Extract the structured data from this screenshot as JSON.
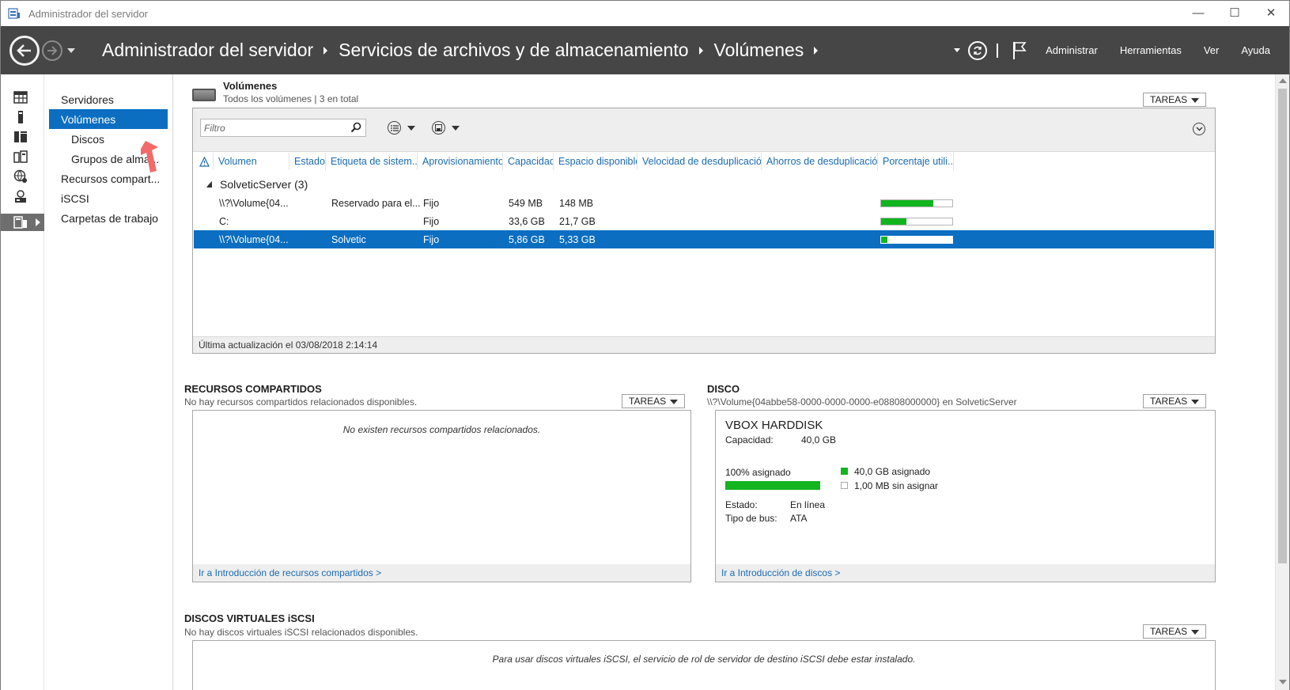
{
  "window": {
    "title": "Administrador del servidor",
    "controls": {
      "minimize": "—",
      "maximize": "☐",
      "close": "✕"
    }
  },
  "header": {
    "breadcrumbs": [
      "Administrador del servidor",
      "Servicios de archivos y de almacenamiento",
      "Volúmenes"
    ],
    "menu": [
      "Administrar",
      "Herramientas",
      "Ver",
      "Ayuda"
    ]
  },
  "rail": {
    "icons": [
      "dashboard-icon",
      "server-icon",
      "all-servers-icon",
      "file-services-icon",
      "iis-icon",
      "remote-access-icon",
      "storage-icon"
    ]
  },
  "nav": {
    "items": [
      {
        "label": "Servidores",
        "level": 0,
        "active": false
      },
      {
        "label": "Volúmenes",
        "level": 0,
        "active": true
      },
      {
        "label": "Discos",
        "level": 1,
        "active": false
      },
      {
        "label": "Grupos de alma...",
        "level": 1,
        "active": false
      },
      {
        "label": "Recursos compart...",
        "level": 0,
        "active": false
      },
      {
        "label": "iSCSI",
        "level": 0,
        "active": false
      },
      {
        "label": "Carpetas de trabajo",
        "level": 0,
        "active": false
      }
    ]
  },
  "volumes": {
    "title": "Volúmenes",
    "subtitle": "Todos los volúmenes | 3 en total",
    "tasks_label": "TAREAS",
    "filter_placeholder": "Filtro",
    "columns": [
      "Volumen",
      "Estado",
      "Etiqueta de sistem...",
      "Aprovisionamiento",
      "Capacidad",
      "Espacio disponible",
      "Velocidad de desduplicación",
      "Ahorros de desduplicación",
      "Porcentaje utili..."
    ],
    "group": "SolveticServer (3)",
    "rows": [
      {
        "volume": "\\\\?\\Volume{04...",
        "status": "",
        "label": "Reservado para el...",
        "provisioning": "Fijo",
        "capacity": "549 MB",
        "free": "148 MB",
        "used_pct": 73,
        "selected": false
      },
      {
        "volume": "C:",
        "status": "",
        "label": "",
        "provisioning": "Fijo",
        "capacity": "33,6 GB",
        "free": "21,7 GB",
        "used_pct": 35,
        "selected": false
      },
      {
        "volume": "\\\\?\\Volume{04...",
        "status": "",
        "label": "Solvetic",
        "provisioning": "Fijo",
        "capacity": "5,86 GB",
        "free": "5,33 GB",
        "used_pct": 9,
        "selected": true
      }
    ],
    "last_update": "Última actualización el 03/08/2018 2:14:14"
  },
  "shares": {
    "title": "RECURSOS COMPARTIDOS",
    "subtitle": "No hay recursos compartidos relacionados disponibles.",
    "tasks_label": "TAREAS",
    "empty": "No existen recursos compartidos relacionados.",
    "link": "Ir a Introducción de recursos compartidos >"
  },
  "disk": {
    "title": "DISCO",
    "subtitle": "\\\\?\\Volume{04abbe58-0000-0000-0000-e08808000000} en SolveticServer",
    "tasks_label": "TAREAS",
    "name": "VBOX HARDDISK",
    "capacity_label": "Capacidad:",
    "capacity_value": "40,0 GB",
    "alloc_label": "100% asignado",
    "alloc_pct": 100,
    "legend_alloc": "40,0 GB asignado",
    "legend_unalloc": "1,00 MB sin asignar",
    "status_label": "Estado:",
    "status_value": "En línea",
    "bus_label": "Tipo de bus:",
    "bus_value": "ATA",
    "link": "Ir a Introducción de discos >",
    "colors": {
      "allocated": "#12b51e"
    }
  },
  "iscsi": {
    "title": "DISCOS VIRTUALES iSCSI",
    "subtitle": "No hay discos virtuales iSCSI relacionados disponibles.",
    "tasks_label": "TAREAS",
    "empty": "Para usar discos virtuales iSCSI, el servicio de rol de servidor de destino iSCSI debe estar instalado."
  },
  "colors": {
    "accent": "#0b6ec1",
    "header_bg": "#464646",
    "link": "#1a6bb5"
  }
}
